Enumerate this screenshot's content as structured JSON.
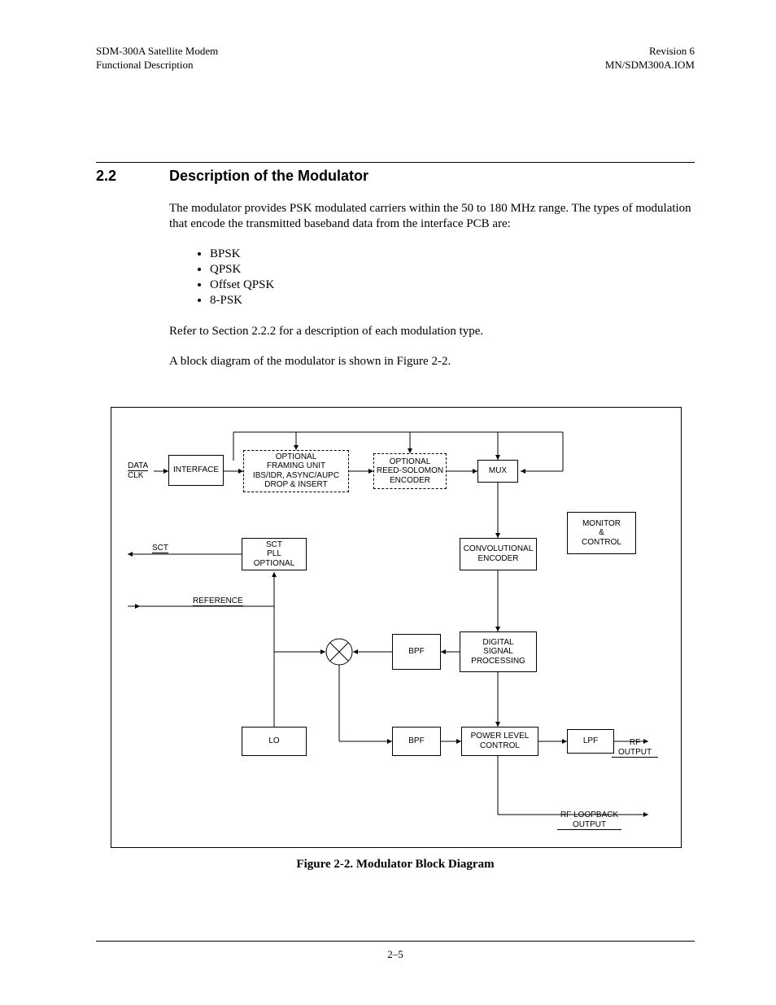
{
  "header": {
    "left1": "SDM-300A Satellite Modem",
    "left2": "Functional Description",
    "right1": "Revision 6",
    "right2": "MN/SDM300A.IOM"
  },
  "section": {
    "num": "2.2",
    "title": "Description of the Modulator"
  },
  "paragraphs": {
    "p1": "The modulator provides PSK modulated carriers within the 50 to 180 MHz range. The types of modulation that encode the transmitted baseband data from the interface PCB are:",
    "p2": "Refer to Section 2.2.2 for a description of each modulation type.",
    "p3": "A block diagram of the modulator is shown in Figure 2-2."
  },
  "list": {
    "i1": "BPSK",
    "i2": "QPSK",
    "i3": "Offset QPSK",
    "i4": "8-PSK"
  },
  "diagram": {
    "data": "DATA",
    "clk": "CLK",
    "interface": "INTERFACE",
    "framing": "OPTIONAL\nFRAMING UNIT\nIBS/IDR, ASYNC/AUPC\nDROP & INSERT",
    "reed": "OPTIONAL\nREED-SOLOMON\nENCODER",
    "mux": "MUX",
    "monitor": "MONITOR\n&\nCONTROL",
    "sct": "SCT",
    "sctpll": "SCT\nPLL\nOPTIONAL",
    "conv": "CONVOLUTIONAL\nENCODER",
    "reference": "REFERENCE",
    "bpf": "BPF",
    "dsp": "DIGITAL\nSIGNAL\nPROCESSING",
    "lo": "LO",
    "bpf2": "BPF",
    "plc": "POWER LEVEL\nCONTROL",
    "lpf": "LPF",
    "rfout": "RF\nOUTPUT",
    "rfloop": "RF LOOPBACK\nOUTPUT"
  },
  "caption": "Figure 2-2.  Modulator Block Diagram",
  "pagenum": "2–5"
}
